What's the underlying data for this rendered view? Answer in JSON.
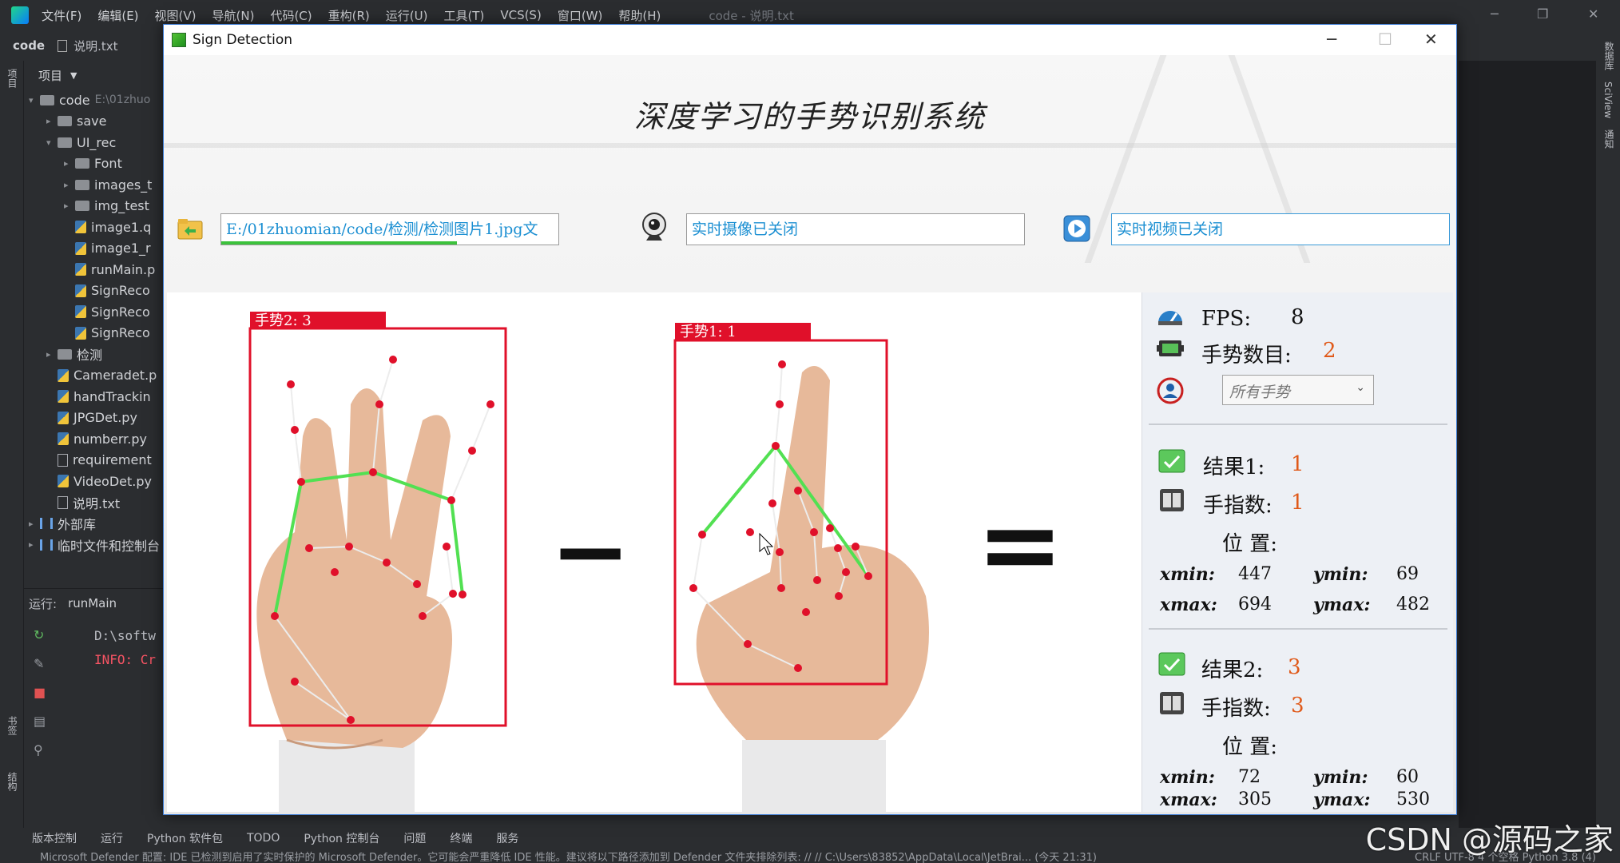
{
  "ide": {
    "menu": [
      "文件(F)",
      "编辑(E)",
      "视图(V)",
      "导航(N)",
      "代码(C)",
      "重构(R)",
      "运行(U)",
      "工具(T)",
      "VCS(S)",
      "窗口(W)",
      "帮助(H)"
    ],
    "title": "code - 说明.txt",
    "breadcrumb_project": "code",
    "breadcrumb_file": "说明.txt",
    "left_strip_label": "项目",
    "left_strip_bottom": [
      "书签",
      "结构"
    ],
    "right_strip_labels": [
      "数据库",
      "SciView",
      "通知"
    ],
    "project_panel_title": "项目",
    "tree": [
      {
        "label": "code",
        "path": "E:\\01zhuo",
        "kind": "folder",
        "depth": 0,
        "arrow": "▾"
      },
      {
        "label": "save",
        "kind": "folder",
        "depth": 1,
        "arrow": "▸"
      },
      {
        "label": "UI_rec",
        "kind": "folder",
        "depth": 1,
        "arrow": "▾"
      },
      {
        "label": "Font",
        "kind": "folder",
        "depth": 2,
        "arrow": "▸"
      },
      {
        "label": "images_t",
        "kind": "folder",
        "depth": 2,
        "arrow": "▸"
      },
      {
        "label": "img_test",
        "kind": "folder",
        "depth": 2,
        "arrow": "▸"
      },
      {
        "label": "image1.q",
        "kind": "py",
        "depth": 2,
        "arrow": ""
      },
      {
        "label": "image1_r",
        "kind": "py",
        "depth": 2,
        "arrow": ""
      },
      {
        "label": "runMain.p",
        "kind": "py",
        "depth": 2,
        "arrow": ""
      },
      {
        "label": "SignReco",
        "kind": "py",
        "depth": 2,
        "arrow": ""
      },
      {
        "label": "SignReco",
        "kind": "py",
        "depth": 2,
        "arrow": ""
      },
      {
        "label": "SignReco",
        "kind": "py",
        "depth": 2,
        "arrow": ""
      },
      {
        "label": "检测",
        "kind": "folder",
        "depth": 1,
        "arrow": "▸"
      },
      {
        "label": "Cameradet.p",
        "kind": "py",
        "depth": 1,
        "arrow": ""
      },
      {
        "label": "handTrackin",
        "kind": "py",
        "depth": 1,
        "arrow": ""
      },
      {
        "label": "JPGDet.py",
        "kind": "py",
        "depth": 1,
        "arrow": ""
      },
      {
        "label": "numberr.py",
        "kind": "py",
        "depth": 1,
        "arrow": ""
      },
      {
        "label": "requirement",
        "kind": "txt",
        "depth": 1,
        "arrow": ""
      },
      {
        "label": "VideoDet.py",
        "kind": "py",
        "depth": 1,
        "arrow": ""
      },
      {
        "label": "说明.txt",
        "kind": "txt",
        "depth": 1,
        "arrow": ""
      },
      {
        "label": "外部库",
        "kind": "lib",
        "depth": 0,
        "arrow": "▸"
      },
      {
        "label": "临时文件和控制台",
        "kind": "lib",
        "depth": 0,
        "arrow": "▸"
      }
    ],
    "run_label": "运行:",
    "run_tab": "runMain",
    "console_lines": [
      "D:\\softw",
      "INFO: Cr"
    ],
    "bottom_tools": [
      "版本控制",
      "运行",
      "Python 软件包",
      "TODO",
      "Python 控制台",
      "问题",
      "终端",
      "服务"
    ],
    "status_message": "Microsoft Defender 配置: IDE 已检测到启用了实时保护的 Microsoft Defender。它可能会严重降低 IDE 性能。建议将以下路径添加到 Defender 文件夹排除列表: // // C:\\Users\\83852\\AppData\\Local\\JetBrai... (今天 21:31)",
    "status_right": "CRLF   UTF-8   4 个空格   Python 3.8 (4)",
    "watermark": "CSDN @源码之家"
  },
  "app": {
    "window_title": "Sign Detection",
    "heading": "深度学习的手势识别系统",
    "file_path": "E:/01zhuomian/code/检测/检测图片1.jpg文",
    "file_progress": 0.7,
    "camera_status": "实时摄像已关闭",
    "video_status": "实时视频已关闭",
    "minus_symbol": "−",
    "equals_symbol": "=",
    "detections": [
      {
        "label": "手势2: 3",
        "color": "#e0102a"
      },
      {
        "label": "手势1: 1",
        "color": "#e0102a"
      }
    ],
    "fps_label": "FPS:",
    "fps_value": "8",
    "count_label": "手势数目:",
    "count_value": "2",
    "select_value": "所有手势",
    "results": [
      {
        "title": "结果1:",
        "result": "1",
        "fingers_label": "手指数:",
        "fingers": "1",
        "pos_label": "位 置:",
        "xmin": "447",
        "ymin": "69",
        "xmax": "694",
        "ymax": "482"
      },
      {
        "title": "结果2:",
        "result": "3",
        "fingers_label": "手指数:",
        "fingers": "3",
        "pos_label": "位 置:",
        "xmin": "72",
        "ymin": "60",
        "xmax": "305",
        "ymax": "530"
      }
    ],
    "coord_labels": {
      "xmin": "xmin:",
      "ymin": "ymin:",
      "xmax": "xmax:",
      "ymax": "ymax:"
    }
  }
}
